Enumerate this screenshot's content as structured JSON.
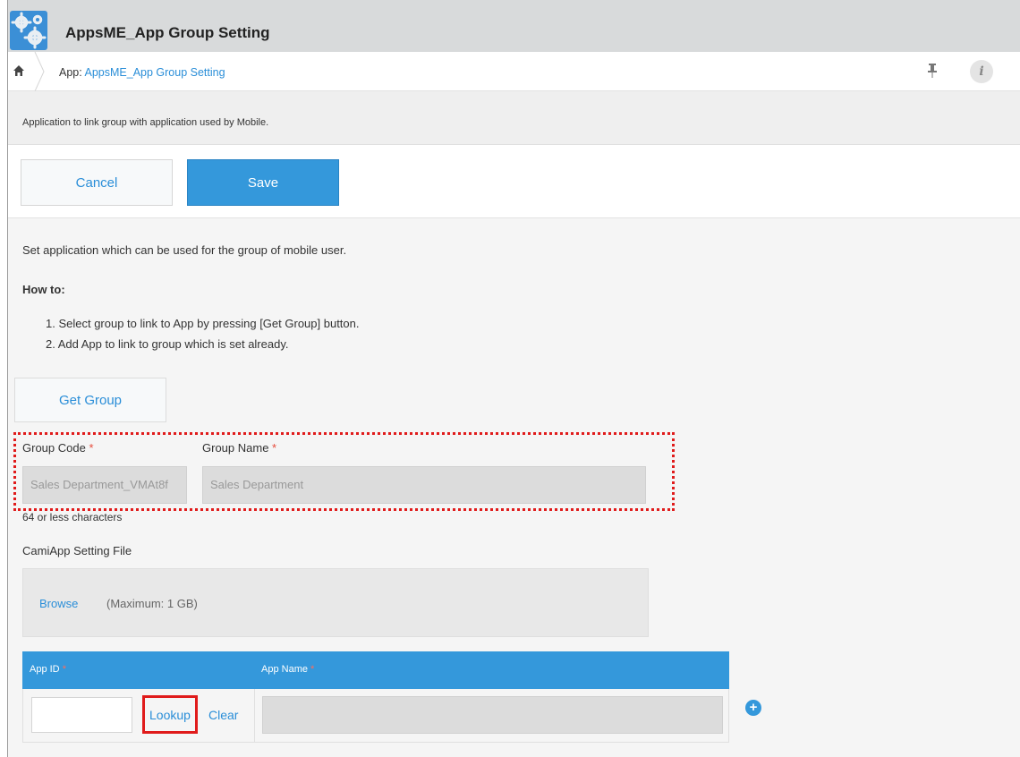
{
  "app": {
    "title": "AppsME_App Group Setting",
    "icon": "gears-icon"
  },
  "breadcrumb": {
    "prefix": "App:",
    "link": "AppsME_App Group Setting"
  },
  "description": "Application to link group with application used by Mobile.",
  "actions": {
    "cancel_label": "Cancel",
    "save_label": "Save"
  },
  "content": {
    "intro": "Set application which can be used for the group of mobile user.",
    "howto_title": "How to:",
    "steps": [
      "1. Select group to link to App by pressing [Get Group] button.",
      "2. Add App to link to group which is set already."
    ],
    "get_group_label": "Get Group"
  },
  "group_fields": {
    "group_code_label": "Group Code",
    "group_code_value": "Sales Department_VMAt8f",
    "group_name_label": "Group Name",
    "group_name_value": "Sales Department",
    "required_mark": "*",
    "hint": "64 or less characters"
  },
  "file_field": {
    "label": "CamiApp Setting File",
    "browse_label": "Browse",
    "max_size": "(Maximum: 1 GB)"
  },
  "app_table": {
    "columns": [
      "App ID",
      "App Name"
    ],
    "lookup_label": "Lookup",
    "clear_label": "Clear",
    "add_symbol": "+"
  },
  "colors": {
    "accent": "#3498db",
    "link": "#2a8ed8",
    "required": "#e74c3c",
    "highlight": "#e01b1b"
  }
}
